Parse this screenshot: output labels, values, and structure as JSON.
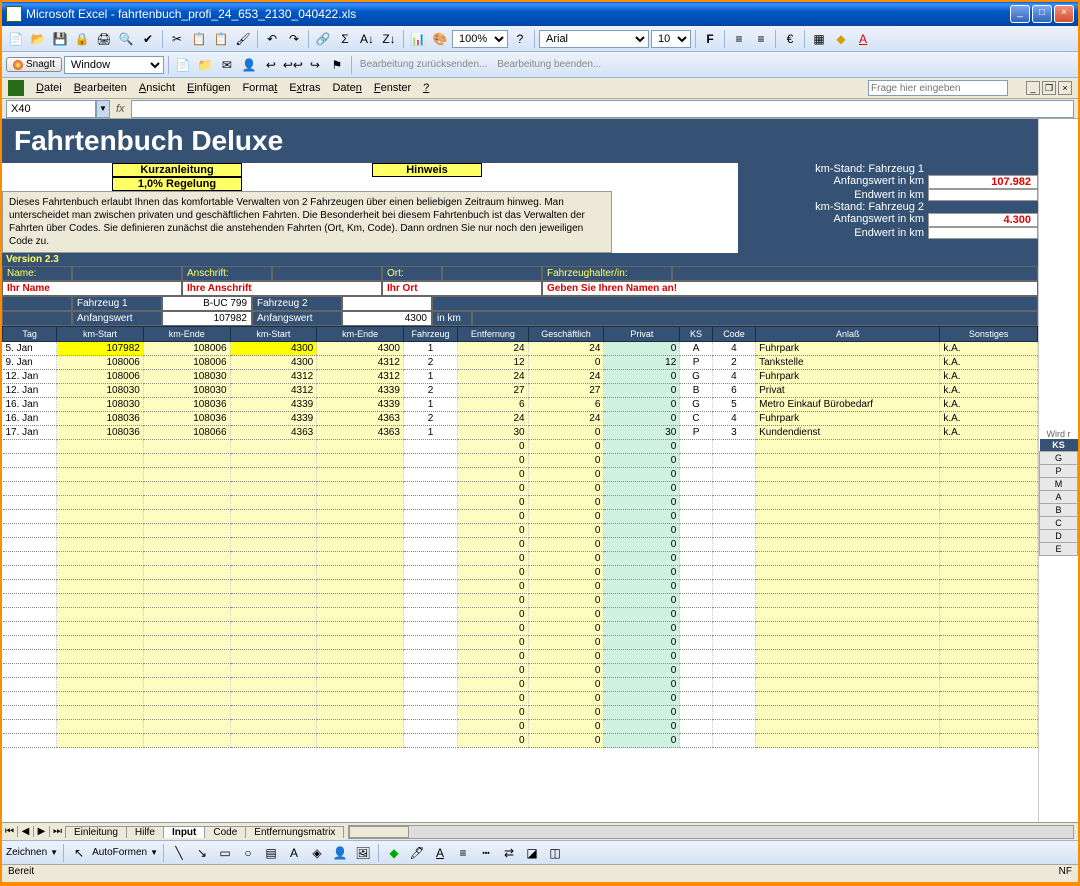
{
  "titlebar": {
    "app": "Microsoft Excel",
    "file": "fahrtenbuch_profi_24_653_2130_040422.xls"
  },
  "toolbar1": {
    "zoom": "100%",
    "font": "Arial",
    "fontsize": "10"
  },
  "snagit": {
    "label": "SnagIt",
    "window": "Window"
  },
  "review": {
    "send_back": "Bearbeitung zurücksenden...",
    "end": "Bearbeitung beenden..."
  },
  "menu": {
    "file": "Datei",
    "edit": "Bearbeiten",
    "view": "Ansicht",
    "insert": "Einfügen",
    "format": "Format",
    "extras": "Extras",
    "data": "Daten",
    "window": "Fenster",
    "help": "?",
    "helpbox": "Frage hier eingeben"
  },
  "namebox": "X40",
  "banner": "Fahrtenbuch Deluxe",
  "buttons": {
    "kurz": "Kurzanleitung",
    "regel": "1,0% Regelung",
    "hinweis": "Hinweis"
  },
  "kmstand": {
    "f1_label": "km-Stand: Fahrzeug 1",
    "f1_start_l": "Anfangswert in km",
    "f1_start_v": "107.982",
    "f1_end_l": "Endwert in km",
    "f1_end_v": "",
    "f2_label": "km-Stand: Fahrzeug 2",
    "f2_start_l": "Anfangswert in km",
    "f2_start_v": "4.300",
    "f2_end_l": "Endwert in km",
    "f2_end_v": ""
  },
  "description": "Dieses Fahrtenbuch erlaubt Ihnen das komfortable Verwalten von 2 Fahrzeugen über einen beliebigen Zeitraum hinweg. Man unterscheidet man zwischen privaten und geschäftlichen Fahrten. Die Besonderheit bei diesem Fahrtenbuch ist das Verwalten der Fahrten über Codes. Sie definieren zunächst die anstehenden Fahrten (Ort, Km, Code). Dann ordnen Sie nur noch den jeweiligen Code zu.",
  "version": "Version 2.3",
  "fields": {
    "name_l": "Name:",
    "name_v": "Ihr Name",
    "anschrift_l": "Anschrift:",
    "anschrift_v": "Ihre Anschrift",
    "ort_l": "Ort:",
    "ort_v": "Ihr Ort",
    "halter_l": "Fahrzeughalter/in:",
    "halter_v": "Geben Sie Ihren Namen an!",
    "f1_l": "Fahrzeug 1",
    "f1_v": "B-UC 799",
    "f1_aw_l": "Anfangswert",
    "f1_aw_v": "107982",
    "f2_l": "Fahrzeug 2",
    "f2_v": "",
    "f2_aw_l": "Anfangswert",
    "f2_aw_v": "4300",
    "inkm": "in km"
  },
  "headers": [
    "Tag",
    "km-Start",
    "km-Ende",
    "km-Start",
    "km-Ende",
    "Fahrzeug",
    "Entfernung",
    "Geschäftlich",
    "Privat",
    "KS",
    "Code",
    "Anlaß",
    "Sonstiges"
  ],
  "rows": [
    {
      "tag": "5. Jan",
      "ks1": "107982",
      "ke1": "108006",
      "ks2": "4300",
      "ke2": "4300",
      "fz": "1",
      "ent": "24",
      "ges": "24",
      "priv": "0",
      "ks": "A",
      "code": "4",
      "anlass": "Fuhrpark",
      "sonst": "k.A.",
      "hl": true
    },
    {
      "tag": "9. Jan",
      "ks1": "108006",
      "ke1": "108006",
      "ks2": "4300",
      "ke2": "4312",
      "fz": "2",
      "ent": "12",
      "ges": "0",
      "priv": "12",
      "ks": "P",
      "code": "2",
      "anlass": "Tankstelle",
      "sonst": "k.A."
    },
    {
      "tag": "12. Jan",
      "ks1": "108006",
      "ke1": "108030",
      "ks2": "4312",
      "ke2": "4312",
      "fz": "1",
      "ent": "24",
      "ges": "24",
      "priv": "0",
      "ks": "G",
      "code": "4",
      "anlass": "Fuhrpark",
      "sonst": "k.A."
    },
    {
      "tag": "12. Jan",
      "ks1": "108030",
      "ke1": "108030",
      "ks2": "4312",
      "ke2": "4339",
      "fz": "2",
      "ent": "27",
      "ges": "27",
      "priv": "0",
      "ks": "B",
      "code": "6",
      "anlass": "Privat",
      "sonst": "k.A."
    },
    {
      "tag": "16. Jan",
      "ks1": "108030",
      "ke1": "108036",
      "ks2": "4339",
      "ke2": "4339",
      "fz": "1",
      "ent": "6",
      "ges": "6",
      "priv": "0",
      "ks": "G",
      "code": "5",
      "anlass": "Metro Einkauf Bürobedarf",
      "sonst": "k.A."
    },
    {
      "tag": "16. Jan",
      "ks1": "108036",
      "ke1": "108036",
      "ks2": "4339",
      "ke2": "4363",
      "fz": "2",
      "ent": "24",
      "ges": "24",
      "priv": "0",
      "ks": "C",
      "code": "4",
      "anlass": "Fuhrpark",
      "sonst": "k.A."
    },
    {
      "tag": "17. Jan",
      "ks1": "108036",
      "ke1": "108066",
      "ks2": "4363",
      "ke2": "4363",
      "fz": "1",
      "ent": "30",
      "ges": "0",
      "priv": "30",
      "ks": "P",
      "code": "3",
      "anlass": "Kundendienst",
      "sonst": "k.A."
    }
  ],
  "empty_zero_rows": 22,
  "side": {
    "wird": "Wird r",
    "hdr": "KS",
    "vals": [
      "G",
      "P",
      "M",
      "A",
      "B",
      "C",
      "D",
      "E"
    ]
  },
  "tabs": {
    "t1": "Einleitung",
    "t2": "Hilfe",
    "t3": "Input",
    "t4": "Code",
    "t5": "Entfernungsmatrix"
  },
  "draw": {
    "zeichnen": "Zeichnen",
    "autoformen": "AutoFormen"
  },
  "status": {
    "ready": "Bereit",
    "nf": "NF"
  }
}
